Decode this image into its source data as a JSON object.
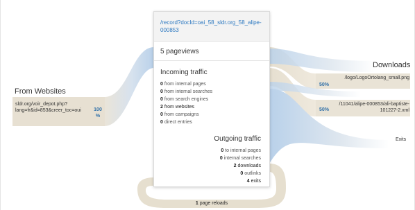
{
  "center": {
    "url": "/record?docId=oai_58_sldr.org_58_alipe-000853",
    "pageviews": "5 pageviews",
    "incoming_title": "Incoming traffic",
    "incoming": [
      {
        "count": "0",
        "label": "from internal pages"
      },
      {
        "count": "0",
        "label": "from internal searches"
      },
      {
        "count": "0",
        "label": "from search engines"
      },
      {
        "count": "2",
        "label": "from websites"
      },
      {
        "count": "0",
        "label": "from campaigns"
      },
      {
        "count": "0",
        "label": "direct entries"
      }
    ],
    "outgoing_title": "Outgoing traffic",
    "outgoing": [
      {
        "count": "0",
        "label": "to internal pages"
      },
      {
        "count": "0",
        "label": "internal searches"
      },
      {
        "count": "2",
        "label": "downloads"
      },
      {
        "count": "0",
        "label": "outlinks"
      },
      {
        "count": "4",
        "label": "exits"
      }
    ],
    "reloads_count": "1",
    "reloads_label": "page reloads"
  },
  "left": {
    "title": "From Websites",
    "item_url": "sldr.org/voir_depot.php?lang=fr&id=853&creer_toc=oui",
    "item_pct": "100 %"
  },
  "right": {
    "downloads_title": "Downloads",
    "downloads": [
      {
        "url": "/logo/LogoOrtolang_small.png",
        "pct": "50%"
      },
      {
        "url": "/11041/alipe-000853/ali-baptiste-101227-2.xml",
        "pct": "50%"
      }
    ],
    "exits_label": "Exits"
  },
  "colors": {
    "flow_in": "#c7d9ec",
    "flow_out": "#e8e2d5",
    "link": "#2d79c1",
    "percent": "#2f6fa8"
  }
}
